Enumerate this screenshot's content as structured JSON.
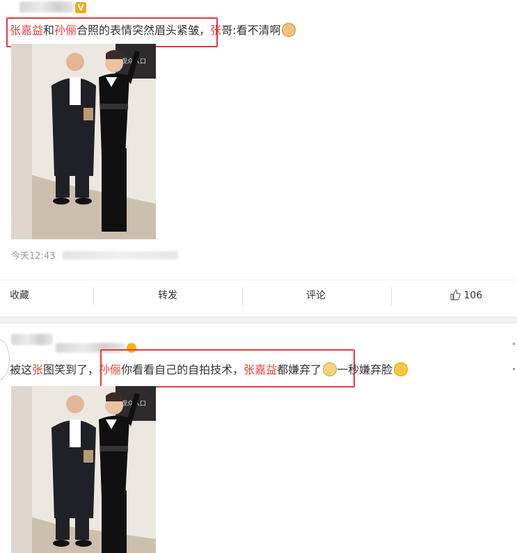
{
  "post1": {
    "text": {
      "n1": "张嘉益",
      "t1": "和",
      "n2": "孙俪",
      "t2": "合照的表情突然眉头紧皱，",
      "n3": "张",
      "t3": "哥:看不清啊"
    },
    "time": "今天12:43",
    "actions": {
      "collect": "收藏",
      "repost": "转发",
      "comment": "评论",
      "like_count": "106"
    },
    "photo_sign": "观众入口"
  },
  "post2": {
    "text": {
      "t1": "被这",
      "n1": "张",
      "t2": "图笑到了，",
      "n2": "孙俪",
      "t3": "你看看自己的自拍技术，",
      "n3": "张嘉益",
      "t4": "都嫌弃了",
      "t5": "一秒嫌弃脸"
    },
    "photo_sign": "观众入口"
  },
  "colors": {
    "highlight": "#e8413d",
    "redbox": "#e23a3e",
    "verified_badge": "#f7a51c",
    "divider": "#f2f2f5"
  },
  "icons": {
    "verified": "verified-v-icon",
    "cat_emoji": "cat-emoji-icon",
    "dog_emoji": "dog-emoji-icon",
    "laugh_emoji": "laughing-emoji-icon",
    "like": "thumbs-up-icon",
    "crown": "crown-badge-icon"
  }
}
